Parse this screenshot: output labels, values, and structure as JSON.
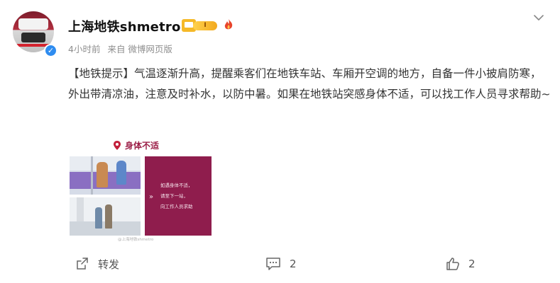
{
  "author": {
    "name": "上海地铁shmetro",
    "level_badge": "I",
    "verified_mark": "✓"
  },
  "meta": {
    "time": "4小时前",
    "source": "来自 微博网页版"
  },
  "post": {
    "text": "【地铁提示】气温逐渐升高，提醒乘客们在地铁车站、车厢开空调的地方，自备一件小披肩防寒，外出带清凉油，注意及时补水，以防中暑。如果在地铁站突感身体不适，可以找工作人员寻求帮助~",
    "image": {
      "title": "身体不适",
      "panel_text": "如遇身体不适，\n请至下一站，\n向工作人员求助",
      "arrows": "»",
      "watermark": "@上海地铁shmetro"
    }
  },
  "actions": {
    "share_label": "转发",
    "comment_count": "2",
    "like_count": "2"
  },
  "icons": {
    "menu": "chevron-down-icon",
    "share": "share-icon",
    "comment": "comment-icon",
    "like": "thumbs-up-icon",
    "location": "location-pin-icon"
  },
  "colors": {
    "accent_red": "#9c1f48",
    "verified_blue": "#2e8cf0",
    "gold": "#f5b928"
  }
}
